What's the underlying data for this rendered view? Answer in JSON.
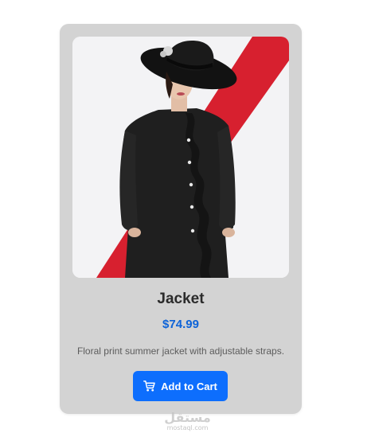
{
  "product": {
    "image_alt": "Woman wearing a black ruffled coat and wide-brim black hat",
    "title": "Jacket",
    "price": "$74.99",
    "description": "Floral print summer jacket with adjustable straps.",
    "cart_label": "Add to Cart",
    "cart_icon": "cart-icon"
  },
  "watermark": {
    "arabic": "مستقل",
    "latin": "mostaql.com"
  },
  "colors": {
    "card_bg": "#d3d3d3",
    "price": "#0d63d8",
    "button_bg": "#0d6efd",
    "button_text": "#ffffff",
    "photo_accent": "#d7202f"
  }
}
